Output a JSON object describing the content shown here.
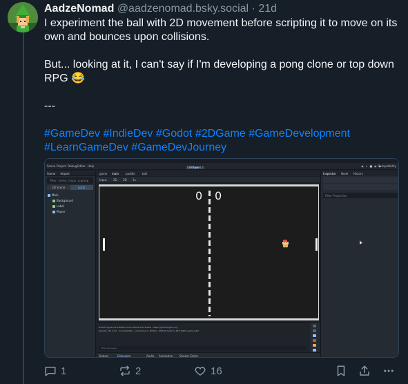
{
  "post": {
    "author": {
      "display_name": "AadzeNomad",
      "handle": "@aadzenomad.bsky.social",
      "separator": "·",
      "age": "21d"
    },
    "text_lines": [
      "I experiment the ball with 2D movement before scripting it to move on its own and bounces upon collisions.",
      "But... looking at it, I can't say if I'm developing a pong clone or top down RPG 😂",
      "---"
    ],
    "hashtags": [
      "#GameDev",
      "#IndieDev",
      "#Godot",
      "#2DGame",
      "#GameDevelopment",
      "#LearnGameDev",
      "#GameDevJourney"
    ],
    "actions": {
      "reply_count": "1",
      "repost_count": "2",
      "like_count": "16"
    }
  },
  "embedded_screenshot": {
    "menu": [
      "Scene",
      "Project",
      "Debug",
      "Editor",
      "Help"
    ],
    "modes": [
      "2D",
      "3D",
      "Script",
      "Game",
      "AssetLib"
    ],
    "active_mode": "Game",
    "renderer": "Compatibility",
    "scene_dock": {
      "tabs": [
        "Scene",
        "Import"
      ],
      "filter_placeholder": "Filter: name, t:type, g:group",
      "toggle": [
        "2D Scene",
        "Local"
      ],
      "tree": [
        "Main",
        "Background",
        "Label",
        "Player"
      ]
    },
    "scene_tabs": [
      "game",
      "main",
      "paddle",
      "ball"
    ],
    "toolbar": [
      "Input",
      "2D",
      "3D",
      "1x"
    ],
    "game": {
      "score_left": "0",
      "score_right": "0"
    },
    "output": {
      "lines": [
        "Godot Engine v4.4.stable.mono.official.4c311cbee - https://godotengine.org",
        "OpenGL API 3.3.0 - Compatibility - Using Device: NVIDIA - NVIDIA GeForce RTX 4060 Laptop GPU"
      ],
      "filter_placeholder": "Filter Messages"
    },
    "bottom_tabs": [
      "Output",
      "Debugger",
      "Audio",
      "Animation",
      "Shader Editor"
    ],
    "inspector": {
      "tabs": [
        "Inspector",
        "Node",
        "History"
      ],
      "filter_placeholder": "Filter Properties"
    },
    "colors": {
      "ball": "#e8463c",
      "paddle": "#eeeeee",
      "court_border": "#d9d9d9",
      "hashtag_link": "#1083fe"
    }
  }
}
